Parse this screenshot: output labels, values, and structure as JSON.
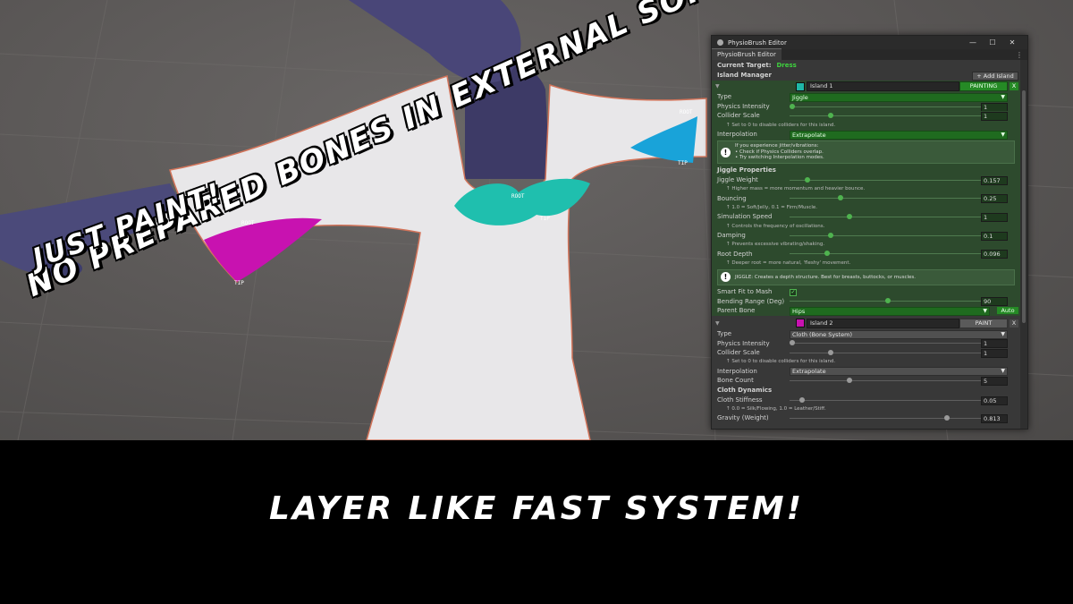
{
  "captions": {
    "main": "No prepared bones in external software!",
    "sub": "Just paint!",
    "bottom": "Layer like fast system!"
  },
  "markers": {
    "root": "ROOT",
    "tip": "TIP"
  },
  "colors": {
    "island1": "#1fb8a6",
    "island2": "#c812b0",
    "shoulder": "#1aa3d8",
    "accent_green": "#3fd03f"
  },
  "editor": {
    "window_title": "PhysioBrush Editor",
    "tab_label": "PhysioBrush Editor",
    "menu_icon": "⋮",
    "buttons": {
      "minimize": "—",
      "maximize": "☐",
      "close": "✕"
    },
    "current_target_label": "Current Target:",
    "current_target_value": "Dress",
    "island_manager_label": "Island Manager",
    "add_island_label": "+ Add Island",
    "island1": {
      "name": "Island 1",
      "paint_label": "PAINTING",
      "remove_label": "X",
      "type_label": "Type",
      "type_value": "Jiggle",
      "physics_intensity_label": "Physics Intensity",
      "physics_intensity_value": "1",
      "physics_intensity_level": 0.0,
      "collider_scale_label": "Collider Scale",
      "collider_scale_value": "1",
      "collider_scale_level": 0.2,
      "collider_hint": "↑ Set to 0 to disable colliders for this island.",
      "interpolation_label": "Interpolation",
      "interpolation_value": "Extrapolate",
      "help1_lines": [
        "If you experience jitter/vibrations:",
        "• Check if Physics Colliders overlap.",
        "• Try switching Interpolation modes."
      ],
      "section_label": "Jiggle Properties",
      "jiggle_weight_label": "Jiggle Weight",
      "jiggle_weight_value": "0.157",
      "jiggle_weight_level": 0.08,
      "jiggle_weight_hint": "↑ Higher mass = more momentum and heavier bounce.",
      "bouncing_label": "Bouncing",
      "bouncing_value": "0.25",
      "bouncing_level": 0.25,
      "bouncing_hint": "↑ 1.0 = Soft/Jelly, 0.1 = Firm/Muscle.",
      "sim_speed_label": "Simulation Speed",
      "sim_speed_value": "1",
      "sim_speed_level": 0.3,
      "sim_speed_hint": "↑ Controls the frequency of oscillations.",
      "damping_label": "Damping",
      "damping_value": "0.1",
      "damping_level": 0.2,
      "damping_hint": "↑ Prevents excessive vibrating/shaking.",
      "root_depth_label": "Root Depth",
      "root_depth_value": "0.096",
      "root_depth_level": 0.18,
      "root_depth_hint": "↑ Deeper root = more natural, 'fleshy' movement.",
      "help2_text": "JIGGLE: Creates a depth structure. Best for breasts, buttocks, or muscles.",
      "smart_fit_label": "Smart Fit to Mash",
      "smart_fit_check": "✓",
      "bending_label": "Bending Range (Deg)",
      "bending_value": "90",
      "bending_level": 0.5,
      "parent_bone_label": "Parent Bone",
      "parent_bone_value": "Hips",
      "auto_label": "Auto"
    },
    "island2": {
      "name": "Island 2",
      "paint_label": "PAINT",
      "remove_label": "X",
      "type_label": "Type",
      "type_value": "Cloth (Bone System)",
      "physics_intensity_label": "Physics Intensity",
      "physics_intensity_value": "1",
      "physics_intensity_level": 0.0,
      "collider_scale_label": "Collider Scale",
      "collider_scale_value": "1",
      "collider_scale_level": 0.2,
      "collider_hint": "↑ Set to 0 to disable colliders for this island.",
      "interpolation_label": "Interpolation",
      "interpolation_value": "Extrapolate",
      "bone_count_label": "Bone Count",
      "bone_count_value": "5",
      "bone_count_level": 0.3,
      "section_label": "Cloth Dynamics",
      "cloth_stiffness_label": "Cloth Stiffness",
      "cloth_stiffness_value": "0.05",
      "cloth_stiffness_level": 0.05,
      "cloth_stiffness_hint": "↑ 0.0 = Silk/Flowing, 1.0 = Leather/Stiff.",
      "gravity_label": "Gravity (Weight)",
      "gravity_value": "0.813",
      "gravity_level": 0.81
    }
  }
}
